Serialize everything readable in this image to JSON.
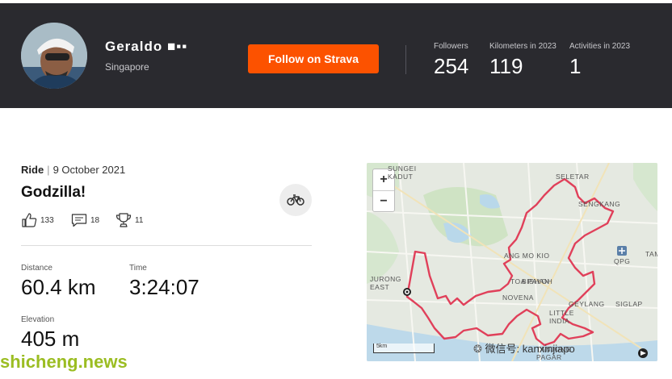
{
  "header": {
    "athlete_name": "Geraldo",
    "location": "Singapore",
    "follow_label": "Follow on Strava",
    "stats": [
      {
        "label": "Followers",
        "value": "254"
      },
      {
        "label": "Kilometers in 2023",
        "value": "119"
      },
      {
        "label": "Activities in 2023",
        "value": "1"
      }
    ]
  },
  "activity": {
    "type": "Ride",
    "date": "9 October 2021",
    "title": "Godzilla!",
    "kudos": "133",
    "comments": "18",
    "achievements": "11",
    "distance_label": "Distance",
    "distance_value": "60.4 km",
    "time_label": "Time",
    "time_value": "3:24:07",
    "elevation_label": "Elevation",
    "elevation_value": "405 m"
  },
  "map": {
    "zoom_in": "+",
    "zoom_out": "−",
    "scale": "5km",
    "route_color": "#e0405a",
    "labels": {
      "sungei_kadut_1": "SUNGEI",
      "sungei_kadut_2": "KADUT",
      "seletar": "SELETAR",
      "sengkang": "SENGKANG",
      "ang_mo_kio": "ANG MO KIO",
      "bishan": "BISHAN",
      "qpg": "QPG",
      "tampines": "TAM",
      "jurong_east_1": "JURONG",
      "jurong_east_2": "EAST",
      "toa_payoh": "TOA PAYOH",
      "novena": "NOVENA",
      "geylang": "GEYLANG",
      "siglap": "SIGLAP",
      "little_india_1": "LITTLE",
      "little_india_2": "INDIA",
      "tanjong_pagar_1": "TANJONG",
      "tanjong_pagar_2": "PAGAR"
    }
  },
  "overlay": {
    "site_watermark": "shicheng.news",
    "wechat_watermark": "微信号: kanxinjiapo"
  }
}
